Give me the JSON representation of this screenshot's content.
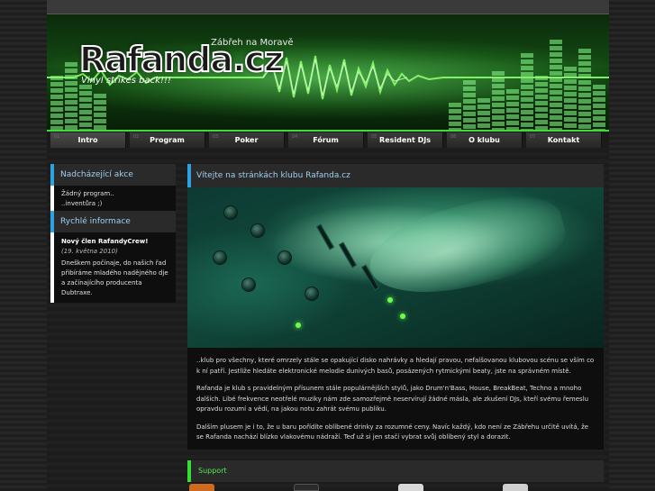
{
  "header": {
    "logo_text": "Rafanda.cz",
    "town": "Zábřeh na Moravě",
    "tagline": "Vinyl strikes back!!!"
  },
  "nav": {
    "items": [
      {
        "num": "01",
        "label": "Intro"
      },
      {
        "num": "02",
        "label": "Program"
      },
      {
        "num": "03",
        "label": "Poker"
      },
      {
        "num": "04",
        "label": "Fórum"
      },
      {
        "num": "05",
        "label": "Resident DJs"
      },
      {
        "num": "06",
        "label": "O klubu"
      },
      {
        "num": "07",
        "label": "Kontakt"
      }
    ]
  },
  "sidebar": {
    "upcoming": {
      "title": "Nadcházející akce",
      "line1": "Žádný program..",
      "line2": "..inventůra ;)"
    },
    "quick": {
      "title": "Rychlé informace",
      "news_title": "Nový člen RafandyCrew!",
      "news_date": "(19. května 2010)",
      "news_body": "Dneškem počínaje, do našich řad přibíráme mladého nadějného dje a začínajícího producenta Dubtraxe."
    }
  },
  "main": {
    "title": "Vítejte na stránkách klubu Rafanda.cz",
    "p1": "..klub pro všechny, které omrzely stále se opakující disko nahrávky a hledají pravou, nefalšovanou klubovou scénu se vším co k ní patří. Jestliže hledáte elektronické melodie dunivých basů, posázených rytmickými beaty, jste na správném místě.",
    "p2": "Rafanda je klub s pravidelným přísunem stále populárnějších stylů, jako Drum'n'Bass, House, BreakBeat, Techno a mnoho dalších. Libé frekvence neotřelé muziky nám zde samozřejmě neservírují žádné másla, ale zkušení DJs, kteří svému řemeslu opravdu rozumí a vědí, na jakou notu zahrát svému publiku.",
    "p3": "Dalším plusem je i to, že u baru pořídíte oblíbené drinky za rozumné ceny. Navíc každý, kdo není ze Zábřehu určitě uvítá, že se Rafanda nachází blízko vlakovému nádraží. Teď už si jen stačí vybrat svůj oblíbený styl a dorazit."
  },
  "support": {
    "title": "Support"
  },
  "colors": {
    "accent_blue": "#2ea2e0",
    "accent_green": "#35e035",
    "nav_top": "#3bdc3b"
  }
}
